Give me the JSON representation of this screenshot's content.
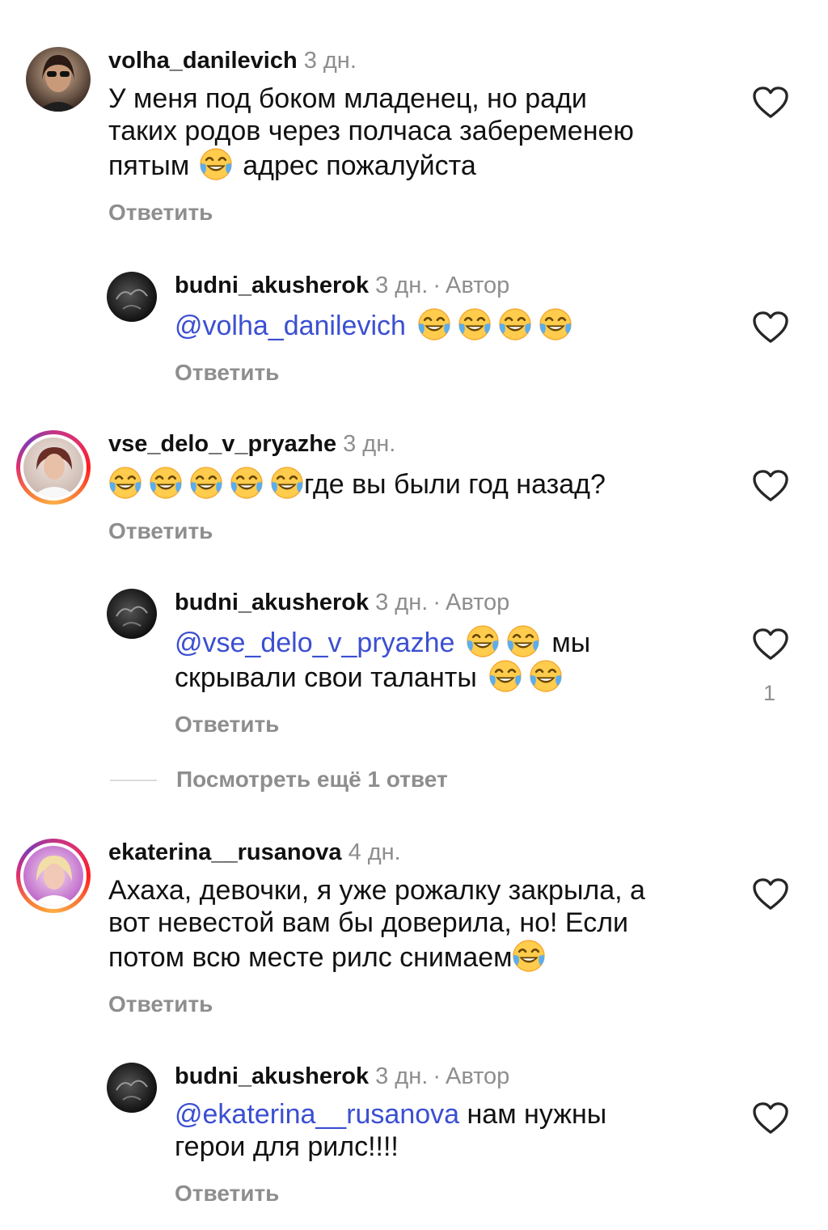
{
  "ui": {
    "reply_label": "Ответить",
    "view_more": "Посмотреть ещё 1 ответ"
  },
  "comments": [
    {
      "username": "volha_danilevich",
      "time": "3 дн.",
      "text_1": "У меня под боком младенец, но ради",
      "text_2": "таких родов через полчаса забеременею",
      "text_3a": "пятым",
      "text_3b": "адрес пожалуйста"
    },
    {
      "username": "budni_akusherok",
      "time": "3 дн.",
      "dot": "·",
      "author": "Автор",
      "mention": "@volha_danilevich"
    },
    {
      "username": "vse_delo_v_pryazhe",
      "time": "3 дн.",
      "text": "где вы были год назад?"
    },
    {
      "username": "budni_akusherok",
      "time": "3 дн.",
      "dot": "·",
      "author": "Автор",
      "mention": "@vse_delo_v_pryazhe",
      "text_1": "мы",
      "text_2": "скрывали свои таланты",
      "likes": "1"
    },
    {
      "username": "ekaterina__rusanova",
      "time": "4 дн.",
      "text_1": "Ахаха, девочки, я уже рожалку закрыла, а",
      "text_2": "вот невестой вам бы доверила, но! Если",
      "text_3": "потом всю месте рилс снимаем"
    },
    {
      "username": "budni_akusherok",
      "time": "3 дн.",
      "dot": "·",
      "author": "Автор",
      "mention": "@ekaterina__rusanova",
      "text_1": "нам нужны",
      "text_2": "герои для рилс!!!!"
    }
  ],
  "colors": {
    "mention": "#3b4fd1",
    "muted": "#8e8e8e",
    "story_ring": "#e1306c"
  },
  "icons": {
    "like": "heart-outline-icon",
    "emoji": "face-with-tears-of-joy-emoji"
  }
}
